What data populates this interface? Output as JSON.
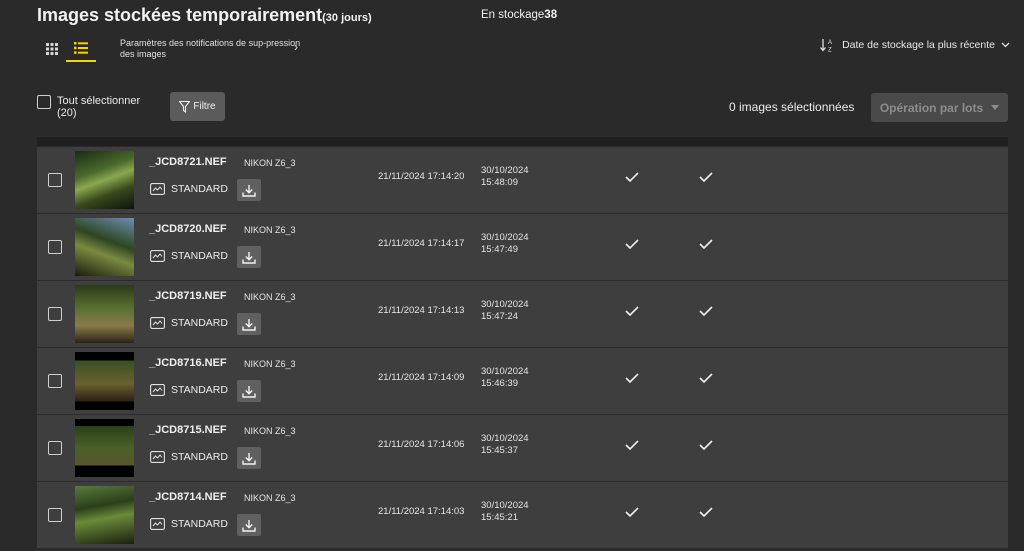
{
  "header": {
    "title": "Images stockées temporairement",
    "title_sub": "(30 jours)",
    "storage_label": "En stockage",
    "storage_count": "38"
  },
  "toolbar": {
    "notification_link": "Paramètres des notifications de sup-pression des images",
    "sort_label": "Date de stockage la plus récente"
  },
  "selection": {
    "select_all_label": "Tout sélectionner",
    "select_all_count": "(20)",
    "filter_label": "Filtre",
    "selected_count": "0 images sélectionnées",
    "batch_label": "Opération par lots"
  },
  "rows": [
    {
      "file": "_JCD8721.NEF",
      "camera": "NIKON Z6_3",
      "quality": "STANDARD",
      "stored": "21/11/2024 17:14:20",
      "shot_date": "30/10/2024",
      "shot_time": "15:48:09"
    },
    {
      "file": "_JCD8720.NEF",
      "camera": "NIKON Z6_3",
      "quality": "STANDARD",
      "stored": "21/11/2024 17:14:17",
      "shot_date": "30/10/2024",
      "shot_time": "15:47:49"
    },
    {
      "file": "_JCD8719.NEF",
      "camera": "NIKON Z6_3",
      "quality": "STANDARD",
      "stored": "21/11/2024 17:14:13",
      "shot_date": "30/10/2024",
      "shot_time": "15:47:24"
    },
    {
      "file": "_JCD8716.NEF",
      "camera": "NIKON Z6_3",
      "quality": "STANDARD",
      "stored": "21/11/2024 17:14:09",
      "shot_date": "30/10/2024",
      "shot_time": "15:46:39"
    },
    {
      "file": "_JCD8715.NEF",
      "camera": "NIKON Z6_3",
      "quality": "STANDARD",
      "stored": "21/11/2024 17:14:06",
      "shot_date": "30/10/2024",
      "shot_time": "15:45:37"
    },
    {
      "file": "_JCD8714.NEF",
      "camera": "NIKON Z6_3",
      "quality": "STANDARD",
      "stored": "21/11/2024 17:14:03",
      "shot_date": "30/10/2024",
      "shot_time": "15:45:21"
    }
  ],
  "colors": {
    "accent": "#f5d400",
    "background": "#2a2a2a",
    "row": "#3e3e3e"
  }
}
